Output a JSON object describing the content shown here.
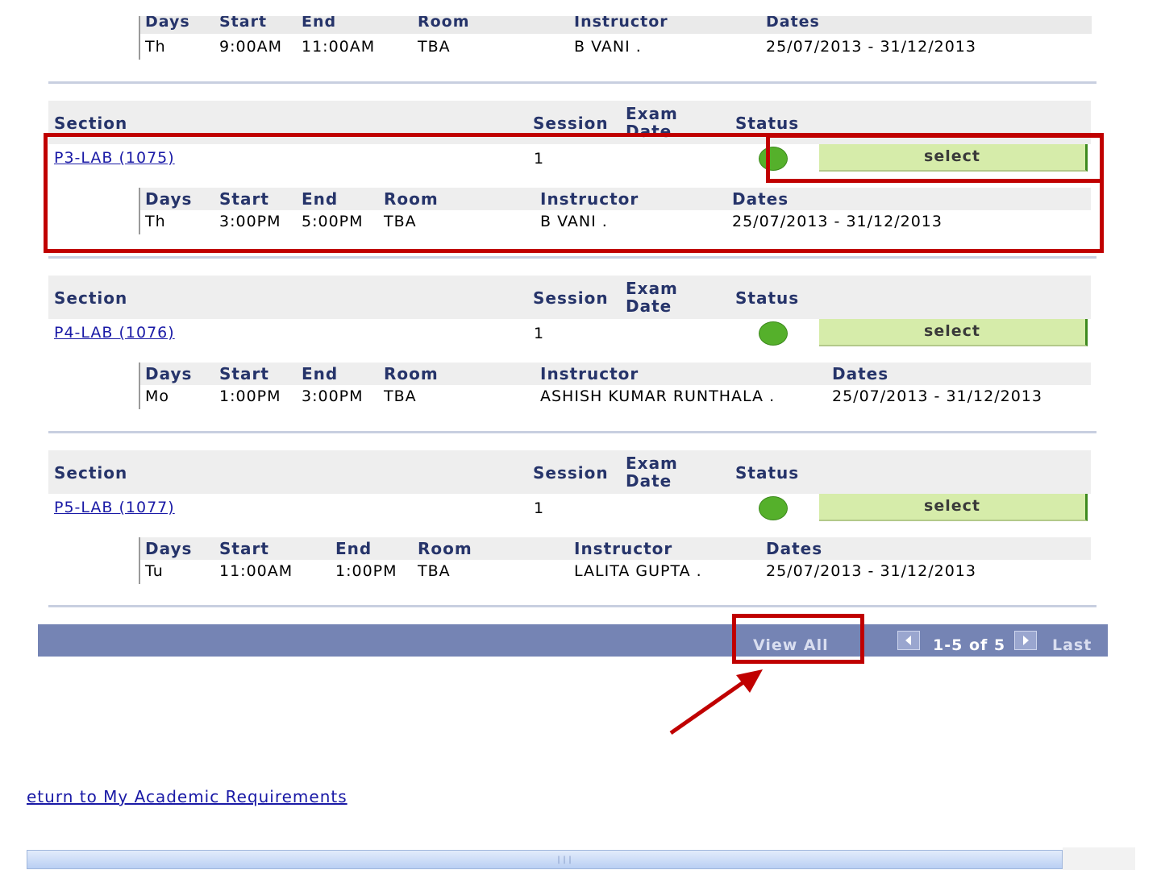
{
  "top_row": {
    "headers": {
      "days": "Days",
      "start": "Start",
      "end": "End",
      "room": "Room",
      "instructor": "Instructor",
      "dates": "Dates"
    },
    "meeting": {
      "days": "Th",
      "start": "9:00AM",
      "end": "11:00AM",
      "room": "TBA",
      "instructor": "B VANI .",
      "dates": "25/07/2013 - 31/12/2013"
    }
  },
  "section_headers": {
    "section": "Section",
    "session": "Session",
    "exam": "Exam",
    "date": "Date",
    "status": "Status"
  },
  "meeting_headers": {
    "days": "Days",
    "start": "Start",
    "end": "End",
    "room": "Room",
    "instructor": "Instructor",
    "dates": "Dates"
  },
  "sections": [
    {
      "name": "P3-LAB (1075)",
      "session": "1",
      "select_label": "select",
      "meeting": {
        "days": "Th",
        "start": "3:00PM",
        "end": "5:00PM",
        "room": "TBA",
        "instructor": "B VANI .",
        "dates": "25/07/2013 - 31/12/2013"
      }
    },
    {
      "name": "P4-LAB (1076)",
      "session": "1",
      "select_label": "select",
      "meeting": {
        "days": "Mo",
        "start": "1:00PM",
        "end": "3:00PM",
        "room": "TBA",
        "instructor": "ASHISH KUMAR RUNTHALA .",
        "dates": "25/07/2013 - 31/12/2013"
      }
    },
    {
      "name": "P5-LAB (1077)",
      "session": "1",
      "select_label": "select",
      "meeting": {
        "days": "Tu",
        "start": "11:00AM",
        "end": "1:00PM",
        "room": "TBA",
        "instructor": "LALITA GUPTA .",
        "dates": "25/07/2013 - 31/12/2013"
      }
    }
  ],
  "navbar": {
    "view_all": "View All",
    "range": "1-5 of 5",
    "last": "Last"
  },
  "return_link": "eturn to My Academic Requirements",
  "colors": {
    "accent_red": "#c00000",
    "status_green": "#55b02b",
    "nav_bar": "#7584b4"
  }
}
